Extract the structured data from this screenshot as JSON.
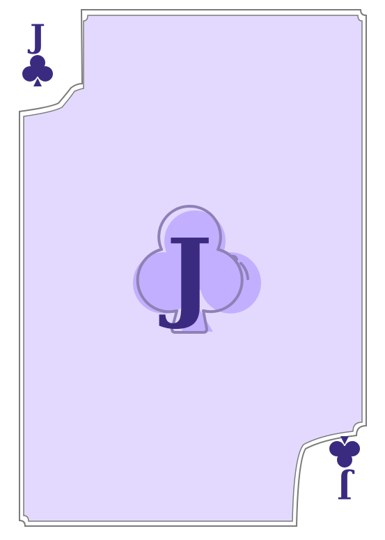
{
  "card": {
    "rank": "J",
    "suit": "clubs"
  },
  "icons": {
    "corner_suit": "club-icon",
    "center_suit": "club-icon"
  },
  "colors": {
    "background": "#ffffff",
    "frame_stroke": "#7a7a7a",
    "card_fill": "#e3d9ff",
    "suit_dark": "#3b2b80",
    "center_suit_fill": "#c2afff",
    "center_suit_stroke": "#8f81b6"
  }
}
